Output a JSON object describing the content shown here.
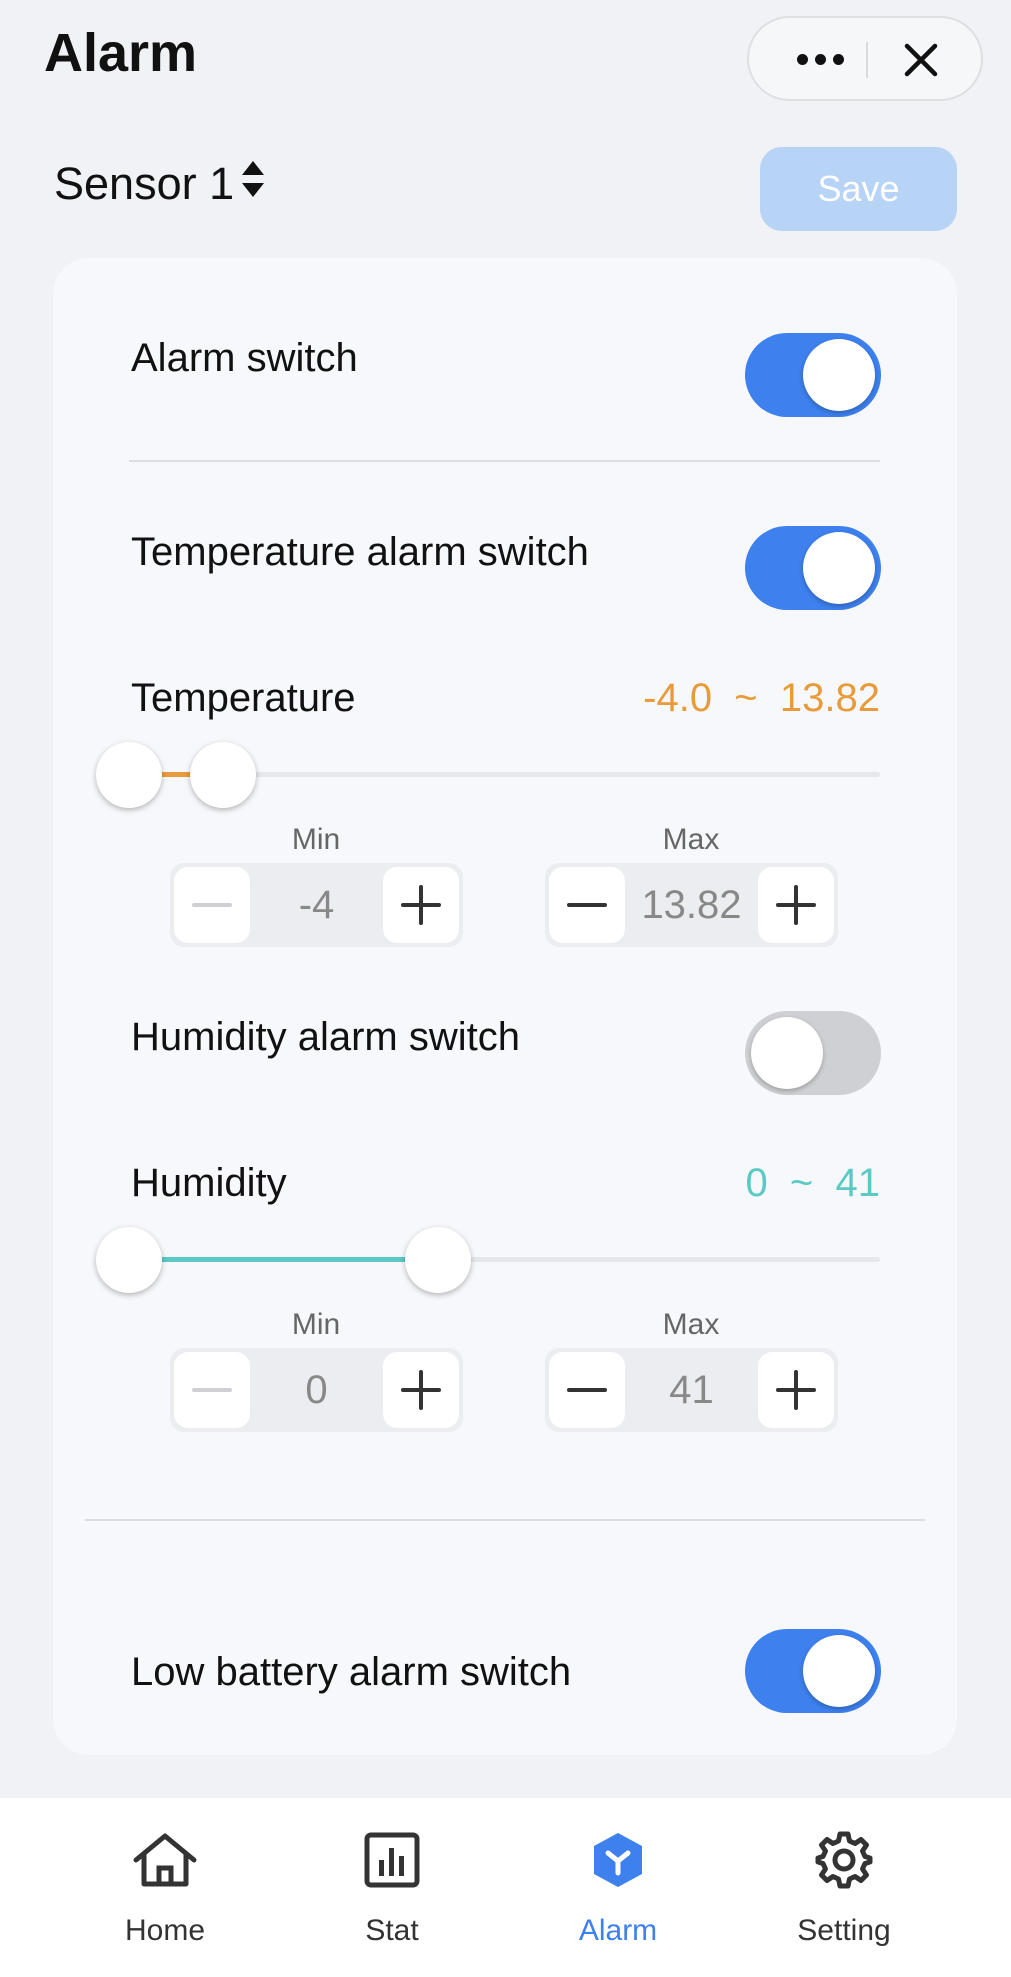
{
  "header": {
    "title": "Alarm"
  },
  "icons": [
    "more-icon",
    "close-icon",
    "sort-arrows-icon",
    "minus-icon",
    "plus-icon",
    "home-icon",
    "stat-icon",
    "alarm-icon",
    "gear-icon"
  ],
  "sensor": {
    "label": "Sensor 1",
    "save_label": "Save"
  },
  "alarm_switch": {
    "label": "Alarm switch",
    "on": true
  },
  "temperature_switch": {
    "label": "Temperature alarm switch",
    "on": true
  },
  "temperature": {
    "label": "Temperature",
    "range_text": "-4.0  ~  13.82",
    "min": "-4",
    "max": "13.82",
    "min_label": "Min",
    "max_label": "Max",
    "color": "#e89b3a"
  },
  "humidity_switch": {
    "label": "Humidity alarm switch",
    "on": false
  },
  "humidity": {
    "label": "Humidity",
    "range_text": "0  ~  41",
    "min": "0",
    "max": "41",
    "min_label": "Min",
    "max_label": "Max",
    "color": "#5bc9c4"
  },
  "battery_switch": {
    "label": "Low battery alarm switch",
    "on": true
  },
  "tabbar": {
    "items": [
      {
        "label": "Home"
      },
      {
        "label": "Stat"
      },
      {
        "label": "Alarm",
        "active": true
      },
      {
        "label": "Setting"
      }
    ]
  },
  "colors": {
    "accent": "#3d80ee",
    "save_disabled": "#b7d3f6",
    "toggle_off": "#cfd0d3"
  }
}
